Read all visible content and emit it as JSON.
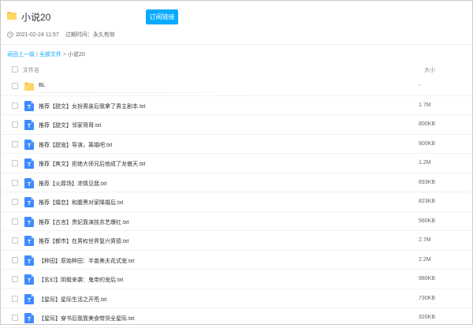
{
  "header": {
    "share_title": "小说20",
    "subscribe_label": "订阅链接",
    "shared_time": "2021-02-24 11:57",
    "expire_label": "过期时间：",
    "expire_value": "永久有效"
  },
  "breadcrumb": {
    "back": "返回上一级",
    "sep": "|",
    "all_files": "全部文件",
    "arrow": ">",
    "current": "小说20"
  },
  "columns": {
    "name": "文件名",
    "size": "大小"
  },
  "colors": {
    "accent": "#09aaff",
    "folder": "#f7c94b",
    "txt_icon": "#3d8bff"
  },
  "files": [
    {
      "name": "BL",
      "size": "-",
      "type": "folder"
    },
    {
      "name": "推荐【甜文】女扮男装后我拿了男主剧本.txt",
      "size": "1.7M",
      "type": "txt"
    },
    {
      "name": "推荐【甜文】邻家哥哥.txt",
      "size": "800KB",
      "type": "txt"
    },
    {
      "name": "推荐【甜宠】导演，离婚吧.txt",
      "size": "800KB",
      "type": "txt"
    },
    {
      "name": "推荐【爽文】拒绝大师兄后他成了龙傲天.txt",
      "size": "1.2M",
      "type": "txt"
    },
    {
      "name": "推荐【火葬场】浓情见我.txt",
      "size": "693KB",
      "type": "txt"
    },
    {
      "name": "推荐【婚恋】和腹黑对家降婚后.txt",
      "size": "823KB",
      "type": "txt"
    },
    {
      "name": "推荐【古言】贵妃靠演技苏艺爆红.txt",
      "size": "560KB",
      "type": "txt"
    },
    {
      "name": "推荐【都市】在男权世界复兴男德.txt",
      "size": "2.7M",
      "type": "txt"
    },
    {
      "name": "【种田】原始种田：半兽美夫花式宠.txt",
      "size": "2.2M",
      "type": "txt"
    },
    {
      "name": "【玄幻】阴鬓来袭：鬼帝的宠后.txt",
      "size": "980KB",
      "type": "txt"
    },
    {
      "name": "【星际】星际生活之开荒.txt",
      "size": "730KB",
      "type": "txt"
    },
    {
      "name": "【星际】穿书后我靠美食带货全星际.txt",
      "size": "320KB",
      "type": "txt"
    }
  ]
}
